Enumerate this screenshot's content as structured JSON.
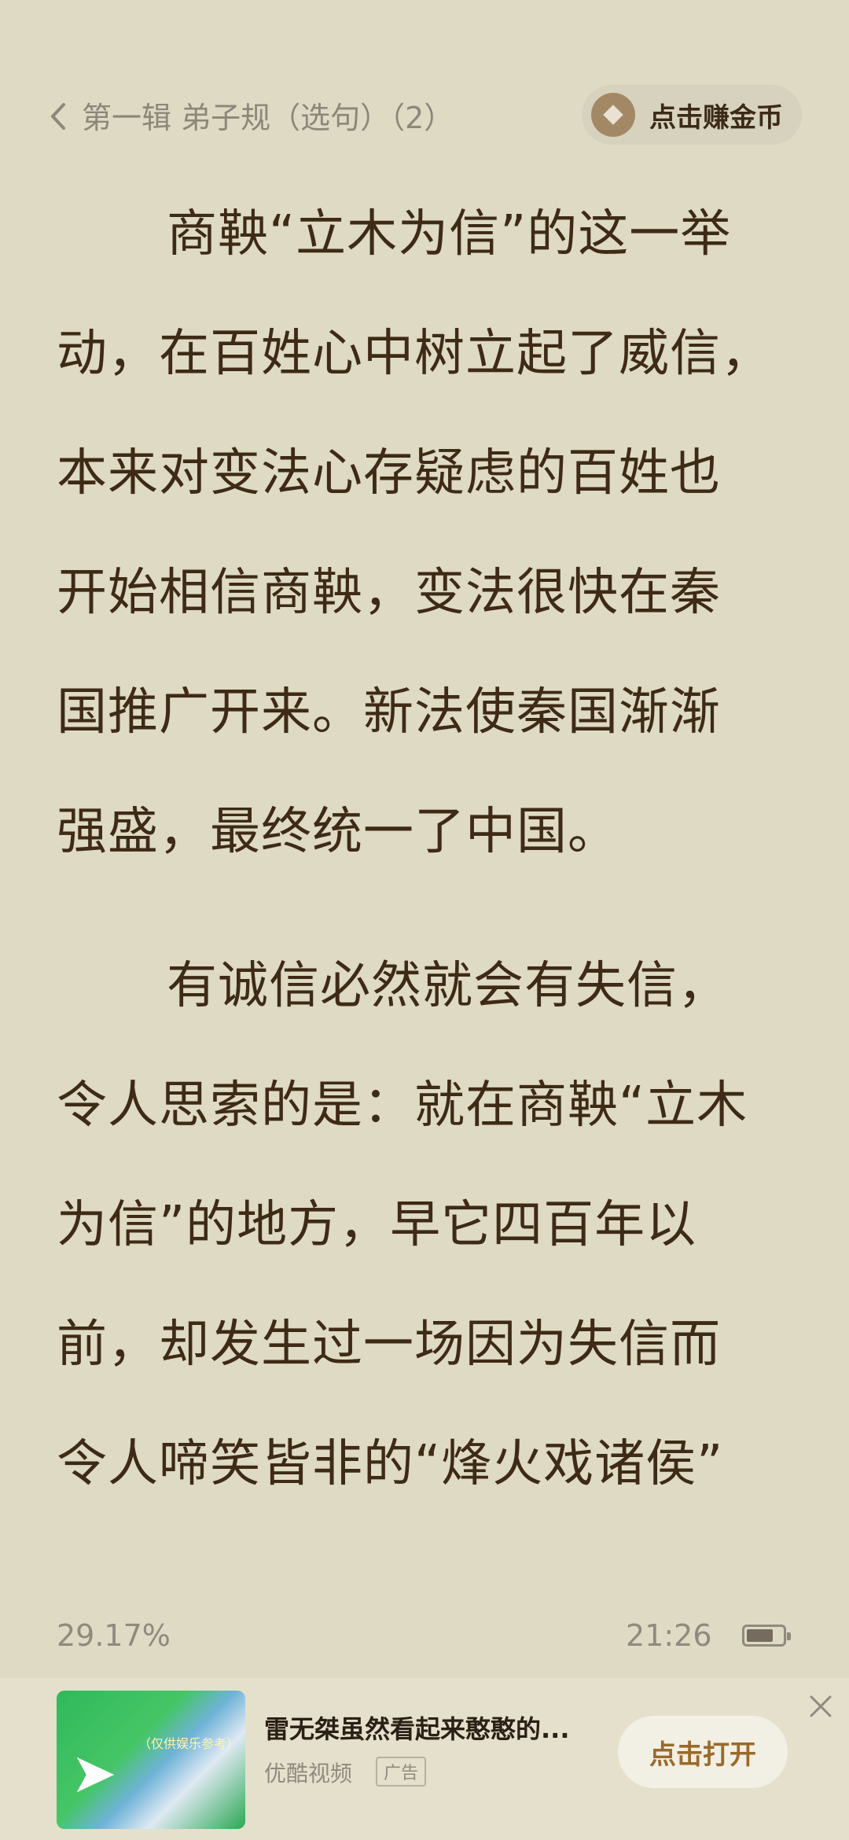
{
  "header": {
    "title": "第一辑 弟子规（选句）（2）",
    "coin_button": "点击赚金币"
  },
  "content": {
    "paragraphs": [
      {
        "lines": [
          "商鞅“立木为信”的这一举",
          "动，在百姓心中树立起了威信，",
          "本来对变法心存疑虑的百姓也",
          "开始相信商鞅，变法很快在秦",
          "国推广开来。新法使秦国渐渐",
          "强盛，最终统一了中国。"
        ]
      },
      {
        "lines": [
          "有诚信必然就会有失信，",
          "令人思索的是：就在商鞅“立木",
          "为信”的地方，早它四百年以",
          "前，却发生过一场因为失信而",
          "令人啼笑皆非的“烽火戏诸侯”"
        ]
      }
    ]
  },
  "status": {
    "progress": "29.17%",
    "time": "21:26",
    "battery_level": 0.75
  },
  "ad": {
    "title": "雷无桀虽然看起来憨憨的...",
    "source": "优酷视频",
    "tag": "广告",
    "open_button": "点击打开",
    "thumb_caption": "（仅供娱乐参考）"
  },
  "icons": {
    "back": "chevron-left-icon",
    "coin": "coin-icon",
    "battery": "battery-icon",
    "close": "close-icon"
  }
}
